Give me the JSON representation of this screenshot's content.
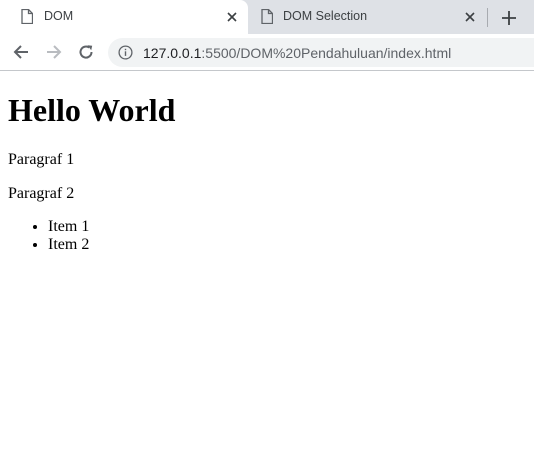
{
  "tabs": [
    {
      "title": "DOM",
      "active": true,
      "icon": "document-icon"
    },
    {
      "title": "DOM Selection",
      "active": false,
      "icon": "document-icon"
    }
  ],
  "toolbar": {
    "back_icon": "back-arrow-icon",
    "forward_icon": "forward-arrow-icon",
    "reload_icon": "reload-icon",
    "new_tab_icon": "plus-icon"
  },
  "address_bar": {
    "host": "127.0.0.1",
    "rest": ":5500/DOM%20Pendahuluan/index.html",
    "icon": "info-icon"
  },
  "page": {
    "heading": "Hello World",
    "paragraphs": [
      "Paragraf 1",
      "Paragraf 2"
    ],
    "list_items": [
      "Item 1",
      "Item 2"
    ]
  },
  "colors": {
    "tabstrip_bg": "#dee1e6",
    "omnibox_bg": "#f1f3f4",
    "icon": "#5f6368"
  }
}
